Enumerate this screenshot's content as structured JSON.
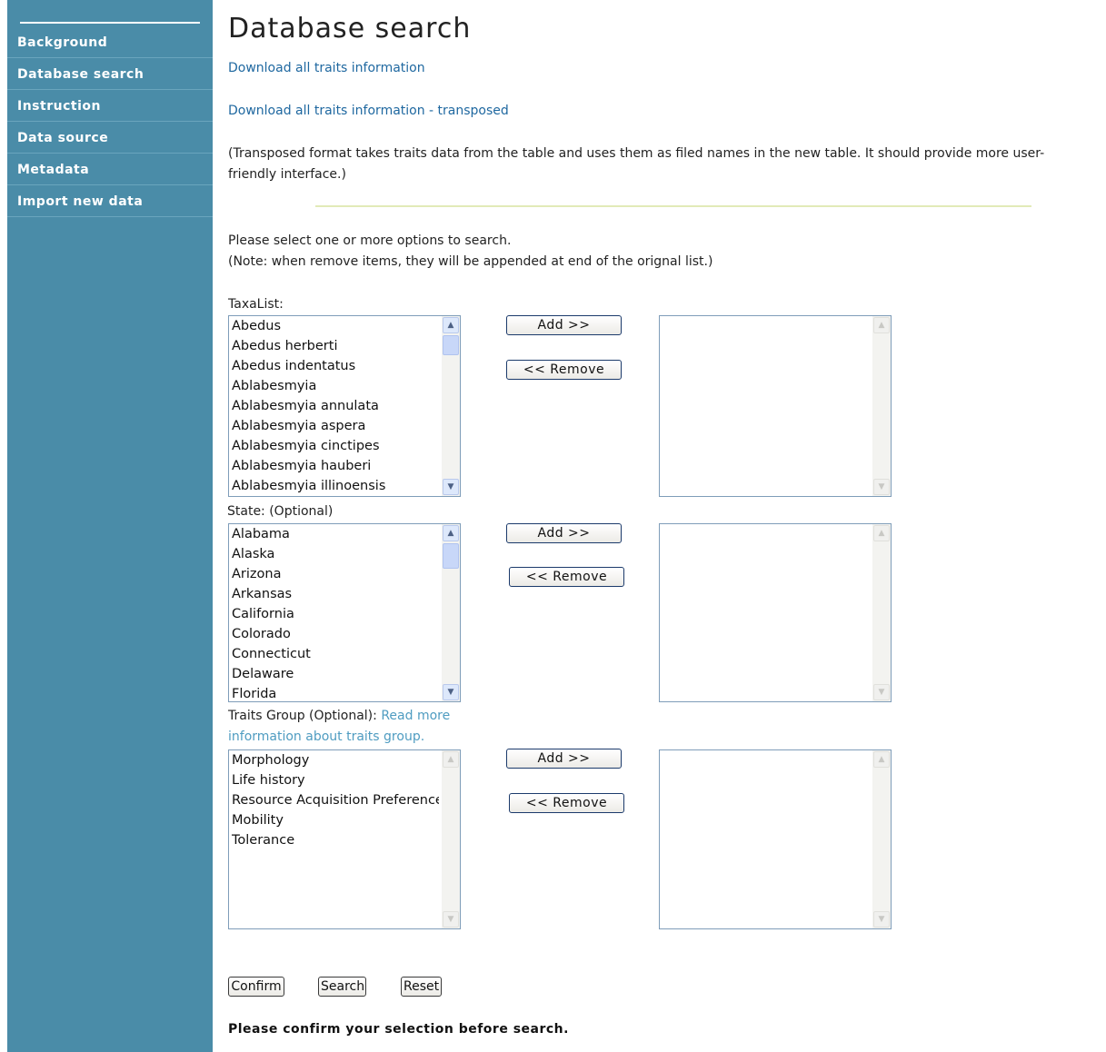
{
  "sidebar": {
    "items": [
      {
        "label": "Background"
      },
      {
        "label": "Database search"
      },
      {
        "label": "Instruction"
      },
      {
        "label": "Data source"
      },
      {
        "label": "Metadata"
      },
      {
        "label": "Import new data"
      }
    ]
  },
  "main": {
    "title": "Database search",
    "download_link": "Download all traits information",
    "download_transposed_link": "Download all traits information - transposed",
    "transposed_note_line1": "(Transposed format takes traits data from the table and uses them as filed names in the new table. It should provide more user-",
    "transposed_note_line2": "friendly interface.)",
    "instructions_line1": "Please select one or more options to search.",
    "instructions_line2": "(Note: when remove items, they will be appended at end of the orignal list.)"
  },
  "taxa": {
    "label": "TaxaList:",
    "options": [
      "Abedus",
      "Abedus herberti",
      "Abedus indentatus",
      "Ablabesmyia",
      "Ablabesmyia annulata",
      "Ablabesmyia aspera",
      "Ablabesmyia cinctipes",
      "Ablabesmyia hauberi",
      "Ablabesmyia illinoensis"
    ],
    "add_label": "Add >>",
    "remove_label": "<< Remove"
  },
  "state": {
    "label": "State: (Optional)",
    "options": [
      "Alabama",
      "Alaska",
      "Arizona",
      "Arkansas",
      "California",
      "Colorado",
      "Connecticut",
      "Delaware",
      "Florida"
    ],
    "add_label": "Add >>",
    "remove_label": "<< Remove"
  },
  "traits": {
    "label": "Traits Group (Optional):",
    "read_more_line1": "Read more",
    "read_more_line2": "information about traits group.",
    "options": [
      "Morphology",
      "Life history",
      "Resource Acquisition Preference",
      "Mobility",
      "Tolerance"
    ],
    "add_label": "Add >>",
    "remove_label": "<< Remove"
  },
  "actions": {
    "confirm_label": "Confirm",
    "search_label": "Search",
    "reset_label": "Reset",
    "confirm_note": "Please confirm your selection before search."
  },
  "colors": {
    "sidebar_bg": "#4a8ca8",
    "link": "#1f68a0",
    "read_more": "#4f9cc1"
  }
}
